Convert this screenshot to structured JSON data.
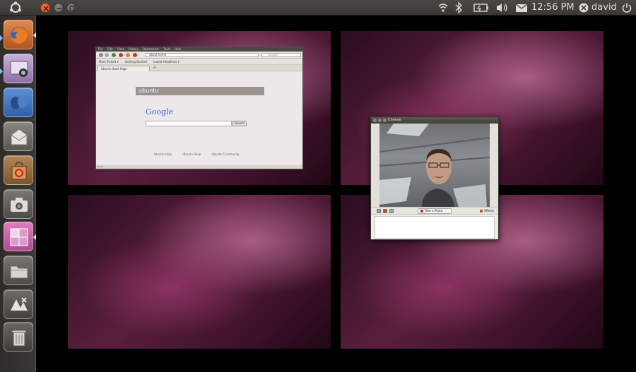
{
  "panel": {
    "clock": "12:56 PM",
    "user": "david",
    "indicators": [
      "wifi-icon",
      "bluetooth-icon",
      "battery-icon",
      "volume-icon",
      "mail-icon"
    ]
  },
  "launcher": {
    "items": [
      {
        "name": "firefox",
        "icon": "firefox-icon"
      },
      {
        "name": "cheese",
        "icon": "webcam-icon"
      },
      {
        "name": "empathy",
        "icon": "chat-icon"
      },
      {
        "name": "mail",
        "icon": "mail-icon"
      },
      {
        "name": "software-center",
        "icon": "shopping-bag-icon"
      },
      {
        "name": "shotwell",
        "icon": "camera-icon"
      },
      {
        "name": "workspace-switcher",
        "icon": "workspaces-icon"
      },
      {
        "name": "files",
        "icon": "folder-icon"
      },
      {
        "name": "applications",
        "icon": "apps-icon"
      },
      {
        "name": "trash",
        "icon": "trash-icon"
      }
    ]
  },
  "firefox": {
    "menu": [
      "File",
      "Edit",
      "View",
      "History",
      "Bookmarks",
      "Tools",
      "Help"
    ],
    "url": "about:home",
    "search_placeholder": "Google",
    "bookmarks": [
      "Most Visited ▾",
      "Getting Started",
      "Latest Headlines ▾"
    ],
    "tab": "Ubuntu Start Page",
    "ubuntu_label": "ubuntu",
    "google_label": "Google",
    "search_button": "Search",
    "links": [
      "Ubuntu Help",
      "Ubuntu Shop",
      "Ubuntu Community"
    ],
    "status": "Done"
  },
  "cheese": {
    "title": "Cheese",
    "take_photo": "Take a Photo",
    "effects": "Effects"
  },
  "colors": {
    "accent": "#dd4814",
    "panel": "#3c3b37",
    "launcher_firefox": "#d96b2b",
    "launcher_workspace": "#c34e9a"
  }
}
